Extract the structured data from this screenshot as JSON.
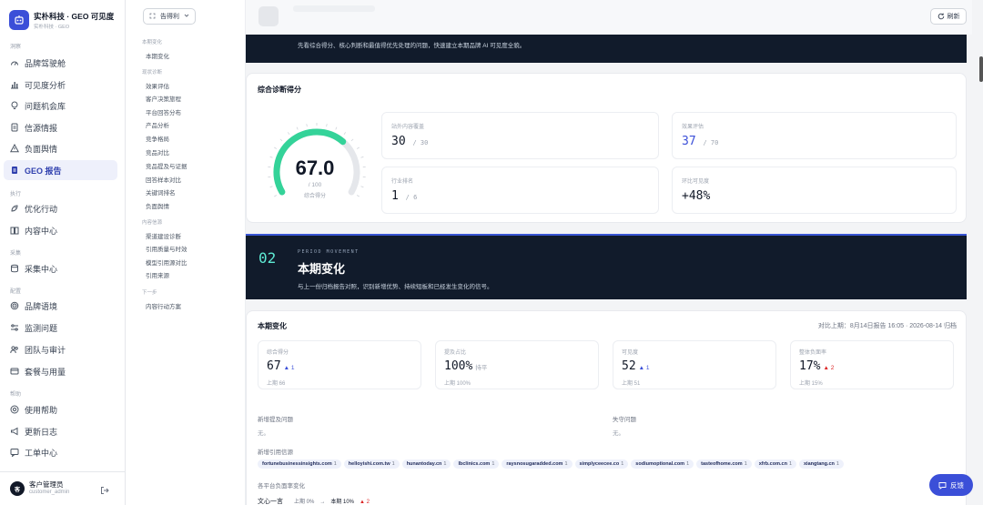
{
  "brand": {
    "name": "实朴科技 · GEO 可见度",
    "sub": "实朴科技 · GEO"
  },
  "sidebar": {
    "sections": [
      "洞察",
      "执行",
      "采集",
      "配置",
      "帮助"
    ],
    "items": [
      {
        "label": "品牌驾驶舱",
        "icon": "gauge-icon"
      },
      {
        "label": "可见度分析",
        "icon": "bar-chart-icon"
      },
      {
        "label": "问题机会库",
        "icon": "lightbulb-icon"
      },
      {
        "label": "信源情报",
        "icon": "document-icon"
      },
      {
        "label": "负面舆情",
        "icon": "alert-icon"
      },
      {
        "label": "GEO 报告",
        "icon": "report-icon",
        "active": true
      },
      {
        "label": "优化行动",
        "icon": "rocket-icon"
      },
      {
        "label": "内容中心",
        "icon": "book-icon"
      },
      {
        "label": "采集中心",
        "icon": "database-icon"
      },
      {
        "label": "品牌语境",
        "icon": "target-icon"
      },
      {
        "label": "监测问题",
        "icon": "sliders-icon"
      },
      {
        "label": "团队与审计",
        "icon": "users-icon"
      },
      {
        "label": "套餐与用量",
        "icon": "card-icon"
      },
      {
        "label": "使用帮助",
        "icon": "help-icon"
      },
      {
        "label": "更新日志",
        "icon": "megaphone-icon"
      },
      {
        "label": "工单中心",
        "icon": "ticket-icon"
      }
    ],
    "user": {
      "name": "客户管理员",
      "role": "customer_admin",
      "avatar": "客"
    }
  },
  "toc": {
    "select": "告得利",
    "sections": [
      {
        "title": "本期变化",
        "items": [
          "本期变化"
        ]
      },
      {
        "title": "现状诊断",
        "items": [
          "效果评估",
          "客户决策旅程",
          "平台回答分布",
          "产品分析",
          "竞争格局",
          "竞品对比",
          "竞品提及与证据",
          "回答样本对比",
          "关键词排名",
          "负面舆情"
        ]
      },
      {
        "title": "内容信源",
        "items": [
          "渠道建设诊断",
          "引用质量与时效",
          "模型引用源对比",
          "引用来源"
        ]
      },
      {
        "title": "下一步",
        "items": [
          "内容行动方案"
        ]
      }
    ]
  },
  "header": {
    "refresh_label": "刷新"
  },
  "band1": {
    "text": "先看综合得分、核心判断和最值得优先处理的问题，快速建立本期品牌 AI 可见度全貌。"
  },
  "score_card": {
    "title": "综合诊断得分",
    "score": "67.0",
    "score_fraction": 0.67,
    "max": "/ 100",
    "label": "综合得分",
    "metrics": [
      {
        "label": "站外内容覆盖",
        "value": "30",
        "den": "/ 30",
        "accent": false
      },
      {
        "label": "效果评估",
        "value": "37",
        "den": "/ 70",
        "accent": true
      },
      {
        "label": "行业排名",
        "value": "1",
        "den": "/ 6",
        "accent": false
      },
      {
        "label": "环比可见度",
        "value": "+48%",
        "den": "",
        "accent": false
      }
    ]
  },
  "band2": {
    "num": "02",
    "kicker": "PERIOD MOVEMENT",
    "title": "本期变化",
    "desc": "与上一份归档报告对照，识别新增优势、持续短板和已经发生变化的信号。"
  },
  "change_card": {
    "title": "本期变化",
    "compare": "对比上期：8月14日报告 16:05 · 2026-08-14 归档",
    "stats": [
      {
        "label": "综合得分",
        "value": "67",
        "change": "▲ 1",
        "dir": "up",
        "prev": "上期 66"
      },
      {
        "label": "提及占比",
        "value": "100%",
        "change": "持平",
        "dir": "flat",
        "prev": "上期 100%"
      },
      {
        "label": "可见度",
        "value": "52",
        "change": "▲ 1",
        "dir": "up",
        "prev": "上期 51"
      },
      {
        "label": "整体负面率",
        "value": "17%",
        "change": "▲ 2",
        "dir": "down",
        "prev": "上期 15%"
      }
    ],
    "new_problems_label": "新增提及问题",
    "new_problems_value": "无。",
    "lost_problems_label": "失守问题",
    "lost_problems_value": "无。",
    "sources_label": "新增引用信源",
    "sources": [
      {
        "name": "fortunebusinessinsights.com",
        "count": "1"
      },
      {
        "name": "helloyishi.com.tw",
        "count": "1"
      },
      {
        "name": "hunantoday.cn",
        "count": "1"
      },
      {
        "name": "lbclinics.com",
        "count": "1"
      },
      {
        "name": "raysnosugaradded.com",
        "count": "1"
      },
      {
        "name": "simplyceecee.co",
        "count": "1"
      },
      {
        "name": "sodiumoptional.com",
        "count": "1"
      },
      {
        "name": "tasteofhome.com",
        "count": "1"
      },
      {
        "name": "xfrb.com.cn",
        "count": "1"
      },
      {
        "name": "xiangtang.cn",
        "count": "1"
      }
    ],
    "platform_label": "各平台负面率变化",
    "platform_rows": [
      {
        "name": "文心一言",
        "prev": "上期 0%",
        "arrow": "→",
        "cur": "本期 10%",
        "change": "▲ 2"
      }
    ]
  },
  "feedback_label": "反馈",
  "colors": {
    "accent": "#3b4fd8",
    "gauge": "#34d399",
    "band": "#111b2b",
    "up": "#3b4fd8",
    "down": "#dc2626"
  }
}
